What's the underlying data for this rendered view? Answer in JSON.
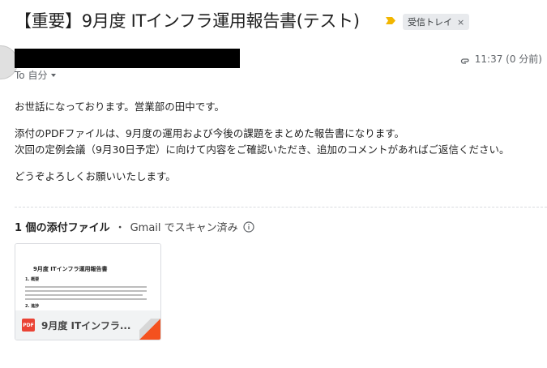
{
  "email": {
    "subject": "【重要】9月度 ITインフラ運用報告書(テスト)",
    "label": "受信トレイ",
    "label_close": "×",
    "to": "To 自分",
    "time": "11:37 (0 分前)",
    "body": [
      "お世話になっております。営業部の田中です。",
      "添付のPDFファイルは、9月度の運用および今後の課題をまとめた報告書になります。",
      "次回の定例会議（9月30日予定）に向けて内容をご確認いただき、追加のコメントがあればご返信ください。",
      "どうぞよろしくお願いいたします。"
    ]
  },
  "attachments": {
    "count_label": "1 個の添付ファイル",
    "separator": "・",
    "scan_label": "Gmail でスキャン済み",
    "items": [
      {
        "name": "9月度 ITインフラ...",
        "type": "PDF",
        "preview": {
          "title": "9月度 ITインフラ運用報告書",
          "section1": "1. 概要",
          "section2": "2. 進捗"
        }
      }
    ]
  },
  "colors": {
    "pdf": "#ea4335",
    "important_marker": "#f2b600",
    "corner_fold": "#f4511e"
  },
  "icons": [
    "important-marker-icon",
    "close-icon",
    "avatar",
    "chevron-down-icon",
    "paperclip-icon",
    "info-icon",
    "pdf-icon"
  ]
}
